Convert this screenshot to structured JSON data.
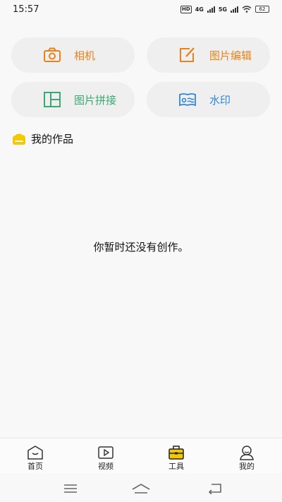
{
  "status_bar": {
    "time": "15:57",
    "hd": "HD",
    "net1": "4G",
    "net2": "5G",
    "battery": "62"
  },
  "tools": {
    "camera": {
      "label": "相机",
      "icon": "camera-icon",
      "color": "#e8821a"
    },
    "edit": {
      "label": "图片编辑",
      "icon": "edit-icon",
      "color": "#e8821a"
    },
    "collage": {
      "label": "图片拼接",
      "icon": "collage-icon",
      "color": "#3aa874"
    },
    "watermark": {
      "label": "水印",
      "icon": "watermark-icon",
      "color": "#2f86d6"
    }
  },
  "works": {
    "title": "我的作品",
    "empty_message": "你暂时还没有创作。"
  },
  "tab_bar": {
    "active_color": "#f5c800",
    "items": [
      {
        "label": "首页",
        "icon": "home-icon"
      },
      {
        "label": "视频",
        "icon": "video-icon"
      },
      {
        "label": "工具",
        "icon": "toolbox-icon",
        "active": true
      },
      {
        "label": "我的",
        "icon": "profile-icon"
      }
    ]
  },
  "system_nav": {
    "buttons": [
      "menu-icon",
      "home-nav-icon",
      "back-icon"
    ]
  }
}
